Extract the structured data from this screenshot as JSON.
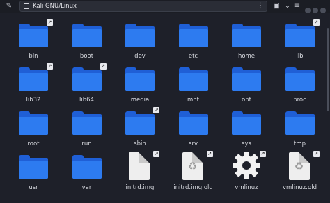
{
  "topbar": {
    "path": "Kali GNU/Linux",
    "icons": {
      "pathbar_toggle": "edit-path-icon",
      "drive": "drive-icon",
      "search": "search-icon",
      "new_folder": "new-folder-icon",
      "view": "view-options-icon",
      "menu": "menu-icon"
    }
  },
  "items": [
    {
      "name": "bin",
      "kind": "folder",
      "link": true
    },
    {
      "name": "boot",
      "kind": "folder",
      "link": false
    },
    {
      "name": "dev",
      "kind": "folder",
      "link": false
    },
    {
      "name": "etc",
      "kind": "folder",
      "link": false
    },
    {
      "name": "home",
      "kind": "folder",
      "link": false
    },
    {
      "name": "lib",
      "kind": "folder",
      "link": true
    },
    {
      "name": "lib32",
      "kind": "folder",
      "link": true
    },
    {
      "name": "lib64",
      "kind": "folder",
      "link": true
    },
    {
      "name": "media",
      "kind": "folder",
      "link": false
    },
    {
      "name": "mnt",
      "kind": "folder",
      "link": false
    },
    {
      "name": "opt",
      "kind": "folder",
      "link": false
    },
    {
      "name": "proc",
      "kind": "folder",
      "link": false
    },
    {
      "name": "root",
      "kind": "folder",
      "link": false
    },
    {
      "name": "run",
      "kind": "folder",
      "link": false
    },
    {
      "name": "sbin",
      "kind": "folder",
      "link": true
    },
    {
      "name": "srv",
      "kind": "folder",
      "link": false
    },
    {
      "name": "sys",
      "kind": "folder",
      "link": false
    },
    {
      "name": "tmp",
      "kind": "folder",
      "link": false
    },
    {
      "name": "usr",
      "kind": "folder",
      "link": false
    },
    {
      "name": "var",
      "kind": "folder",
      "link": false
    },
    {
      "name": "initrd.img",
      "kind": "file",
      "link": true
    },
    {
      "name": "initrd.img.old",
      "kind": "file-recycle",
      "link": true
    },
    {
      "name": "vmlinuz",
      "kind": "executable",
      "link": true
    },
    {
      "name": "vmlinuz.old",
      "kind": "file-recycle",
      "link": true
    }
  ],
  "colors": {
    "background": "#1e2029",
    "folder_front": "#2d7bf0",
    "folder_back": "#1f5fd6"
  }
}
